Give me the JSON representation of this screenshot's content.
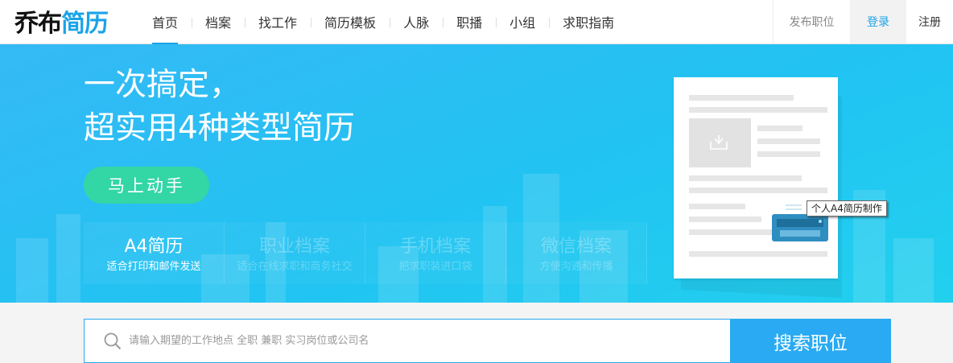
{
  "logo": {
    "part1": "乔布",
    "part2": "简历"
  },
  "nav": {
    "items": [
      {
        "label": "首页",
        "active": true
      },
      {
        "label": "档案"
      },
      {
        "label": "找工作"
      },
      {
        "label": "简历模板"
      },
      {
        "label": "人脉"
      },
      {
        "label": "职播"
      },
      {
        "label": "小组"
      },
      {
        "label": "求职指南"
      }
    ]
  },
  "right_nav": {
    "post_job": "发布职位",
    "login": "登录",
    "register": "注册"
  },
  "banner": {
    "headline_line1": "一次搞定，",
    "headline_line2": "超实用4种类型简历",
    "cta_label": "马上动手",
    "tabs": [
      {
        "title": "A4简历",
        "subtitle": "适合打印和邮件发送",
        "active": true
      },
      {
        "title": "职业档案",
        "subtitle": "适合在线求职和商务社交"
      },
      {
        "title": "手机档案",
        "subtitle": "把求职装进口袋"
      },
      {
        "title": "微信档案",
        "subtitle": "方便沟通和传播"
      }
    ],
    "tooltip": "个人A4简历制作"
  },
  "search": {
    "placeholder": "请输入期望的工作地点 全职 兼职 实习岗位或公司名",
    "button_label": "搜索职位"
  },
  "colors": {
    "brand": "#1aa3e8",
    "cta": "#33d6a5",
    "search_button": "#29aaf2"
  }
}
